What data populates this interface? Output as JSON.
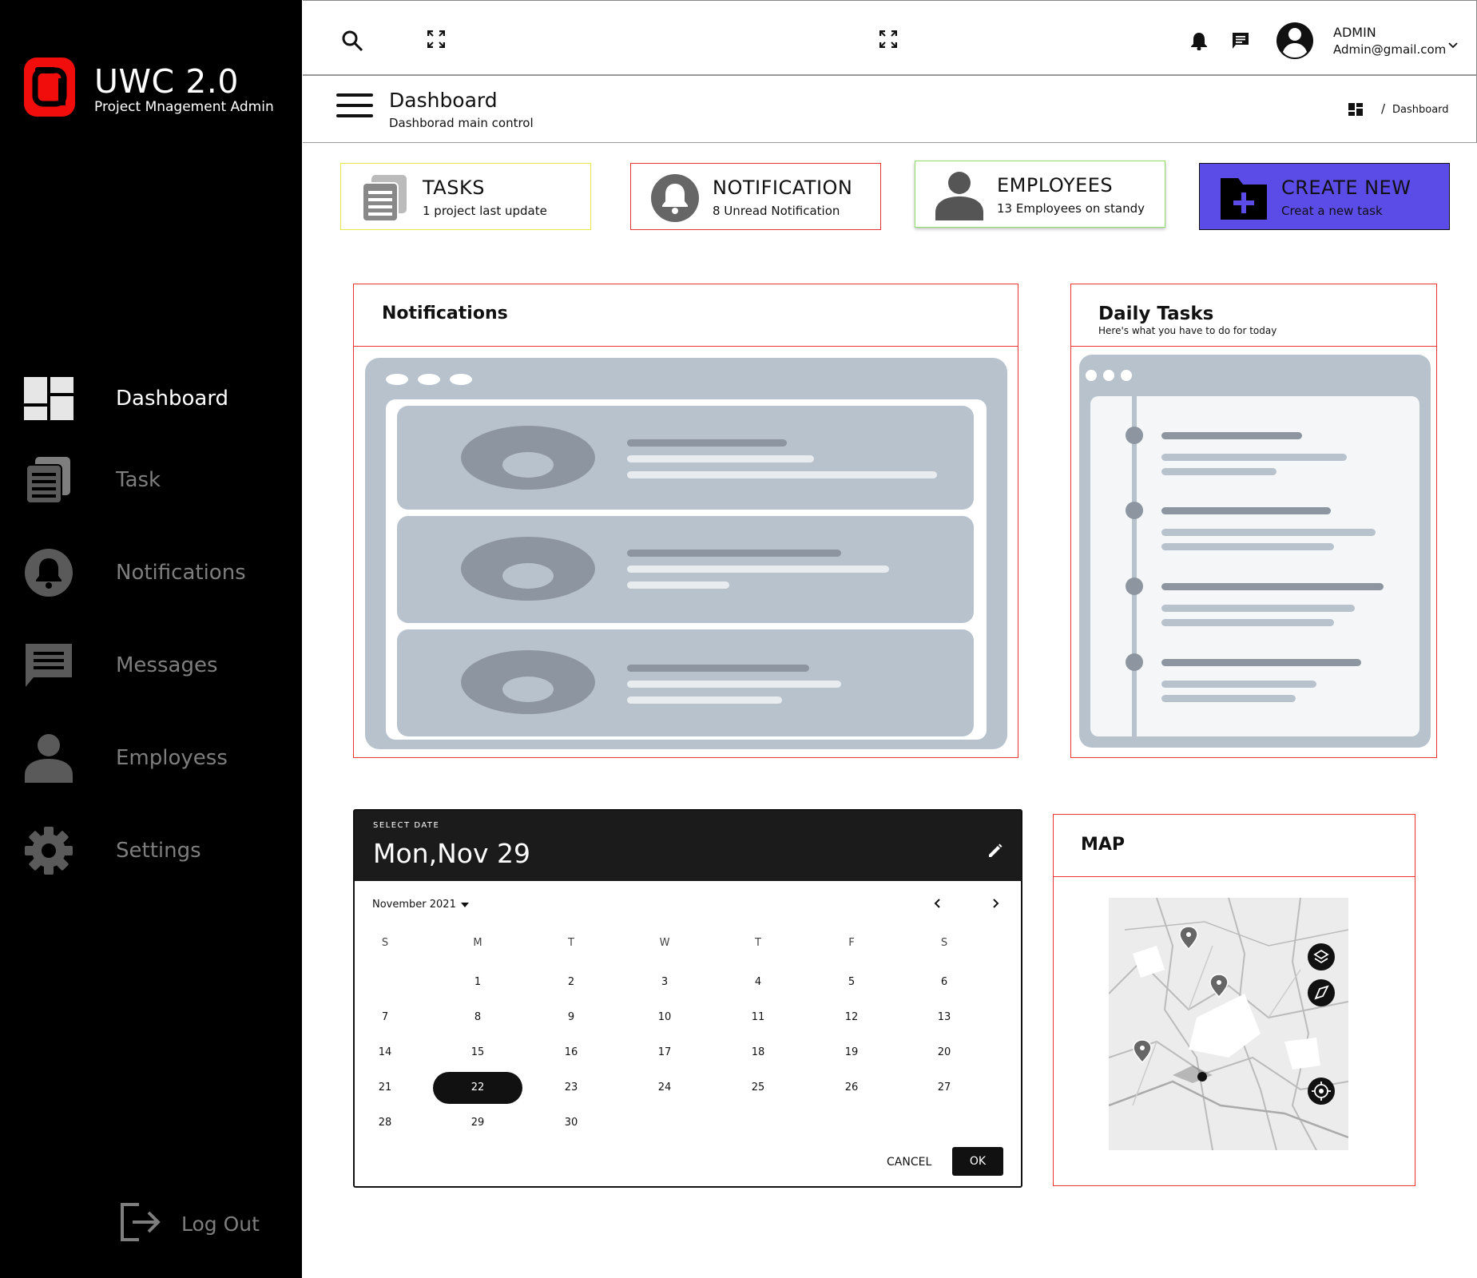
{
  "brand": {
    "title": "UWC 2.0",
    "subtitle": "Project Mnagement Admin"
  },
  "sidebar": {
    "items": [
      {
        "label": "Dashboard",
        "icon": "dashboard-icon",
        "active": true
      },
      {
        "label": "Task",
        "icon": "document-stack-icon"
      },
      {
        "label": "Notifications",
        "icon": "bell-icon"
      },
      {
        "label": "Messages",
        "icon": "message-icon"
      },
      {
        "label": "Employess",
        "icon": "person-icon"
      },
      {
        "label": "Settings",
        "icon": "gear-icon"
      }
    ],
    "logout_label": "Log Out"
  },
  "topbar": {
    "admin_name": "ADMIN",
    "admin_email": "Admin@gmail.com"
  },
  "header": {
    "title": "Dashboard",
    "subtitle": "Dashborad main control",
    "breadcrumb_sep": "/",
    "breadcrumb_current": "Dashboard"
  },
  "cards": [
    {
      "title": "TASKS",
      "subtitle": "1 project last update",
      "border": "#e8e84a"
    },
    {
      "title": "NOTIFICATION",
      "subtitle": "8 Unread Notification",
      "border": "#e33333"
    },
    {
      "title": "EMPLOYEES",
      "subtitle": "13 Employees on standy",
      "border": "#8ee06a"
    },
    {
      "title": "CREATE NEW",
      "subtitle": "Creat a new task",
      "bg": "#5b4ce8"
    }
  ],
  "notifications": {
    "title": "Notifications"
  },
  "daily_tasks": {
    "title": "Daily Tasks",
    "subtitle": "Here's what you have to do for today"
  },
  "calendar": {
    "label": "SELECT DATE",
    "selected_display": "Mon,Nov 29",
    "month_label": "November 2021",
    "weekdays": [
      "S",
      "M",
      "T",
      "W",
      "T",
      "F",
      "S"
    ],
    "days": [
      "1",
      "2",
      "3",
      "4",
      "5",
      "6",
      "7",
      "8",
      "9",
      "10",
      "11",
      "12",
      "13",
      "14",
      "15",
      "16",
      "17",
      "18",
      "19",
      "20",
      "21",
      "22",
      "23",
      "24",
      "25",
      "26",
      "27",
      "28",
      "29",
      "30"
    ],
    "selected_day": "22",
    "cancel_label": "CANCEL",
    "ok_label": "OK"
  },
  "map": {
    "title": "MAP"
  }
}
